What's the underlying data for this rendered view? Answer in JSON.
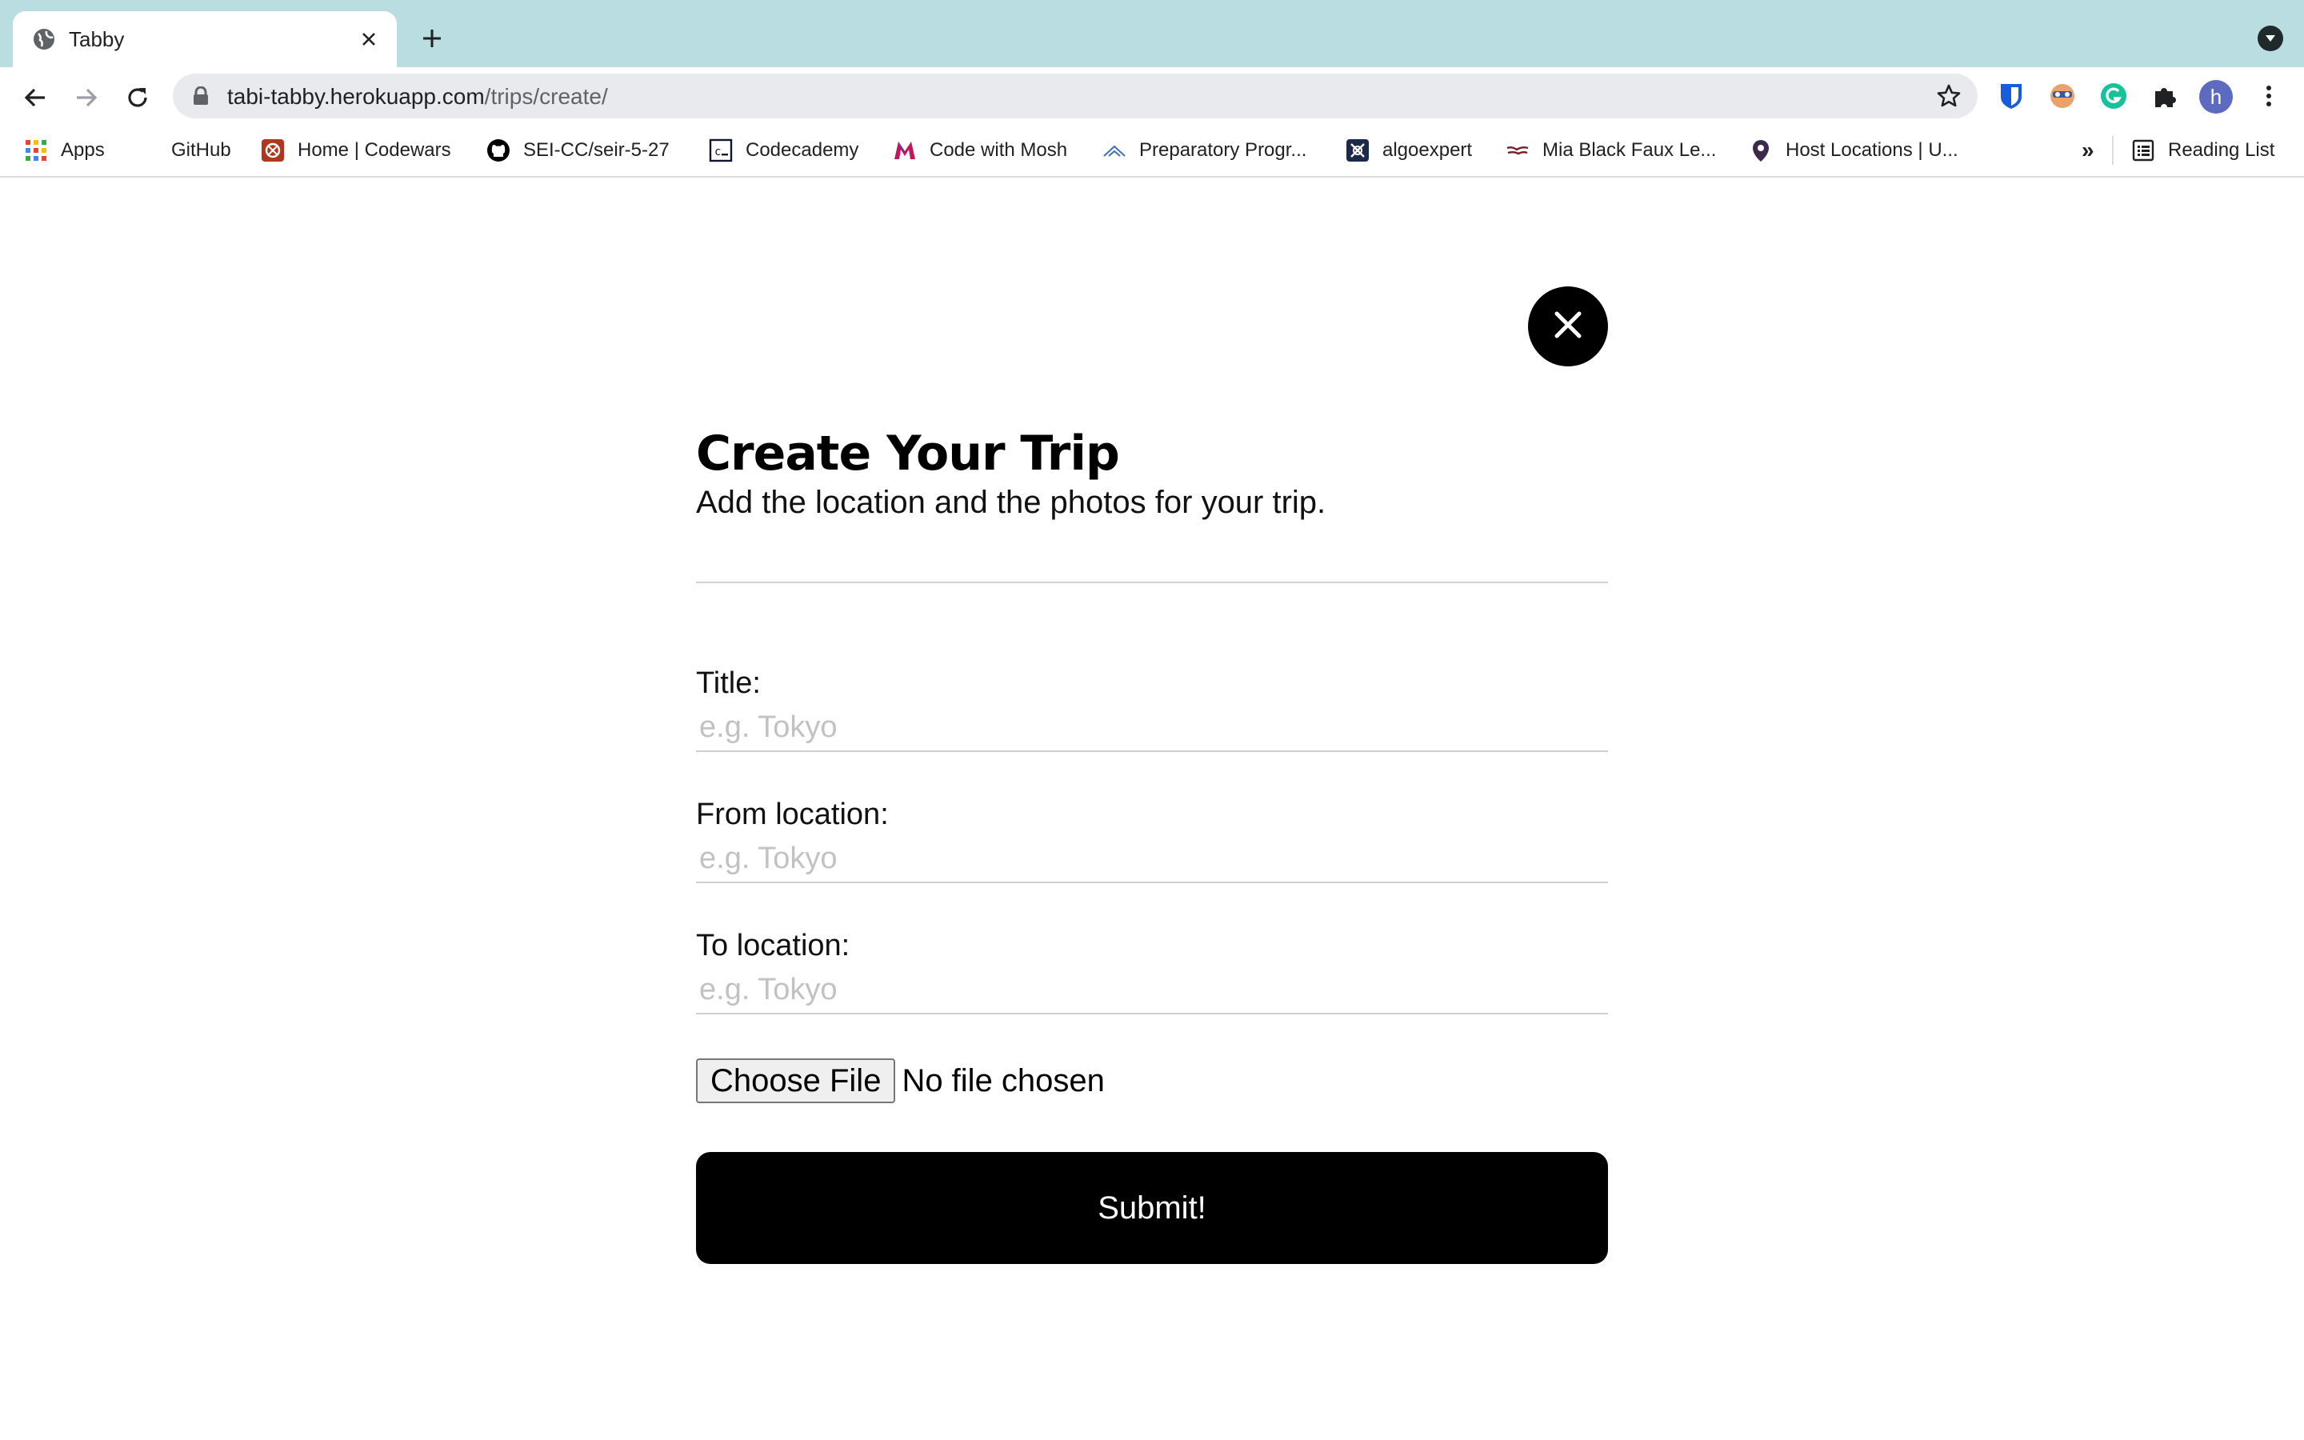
{
  "browser": {
    "tab_title": "Tabby",
    "url_domain": "tabi-tabby.herokuapp.com",
    "url_path": "/trips/create/",
    "profile_initial": "h",
    "bookmarks": [
      {
        "label": "Apps",
        "icon": "apps-grid-icon"
      },
      {
        "label": "GitHub",
        "icon": "github-icon"
      },
      {
        "label": "Home | Codewars",
        "icon": "codewars-icon"
      },
      {
        "label": "SEI-CC/seir-5-27",
        "icon": "github-icon"
      },
      {
        "label": "Codecademy",
        "icon": "codecademy-icon"
      },
      {
        "label": "Code with Mosh",
        "icon": "mosh-icon"
      },
      {
        "label": "Preparatory Progr...",
        "icon": "preparatory-icon"
      },
      {
        "label": "algoexpert",
        "icon": "algoexpert-icon"
      },
      {
        "label": "Mia Black Faux Le...",
        "icon": "store-icon"
      },
      {
        "label": "Host Locations | U...",
        "icon": "location-pin-icon"
      }
    ],
    "overflow_label": "»",
    "reading_list_label": "Reading List"
  },
  "page": {
    "title": "Create Your Trip",
    "subtitle": "Add the location and the photos for your trip.",
    "fields": [
      {
        "label": "Title:",
        "placeholder": "e.g. Tokyo",
        "value": ""
      },
      {
        "label": "From location:",
        "placeholder": "e.g. Tokyo",
        "value": ""
      },
      {
        "label": "To location:",
        "placeholder": "e.g. Tokyo",
        "value": ""
      }
    ],
    "file_button_label": "Choose File",
    "file_status": "No file chosen",
    "submit_label": "Submit!"
  },
  "colors": {
    "tabstrip": "#b9dde1",
    "primary_button": "#000000",
    "placeholder": "#c2c2c2"
  }
}
